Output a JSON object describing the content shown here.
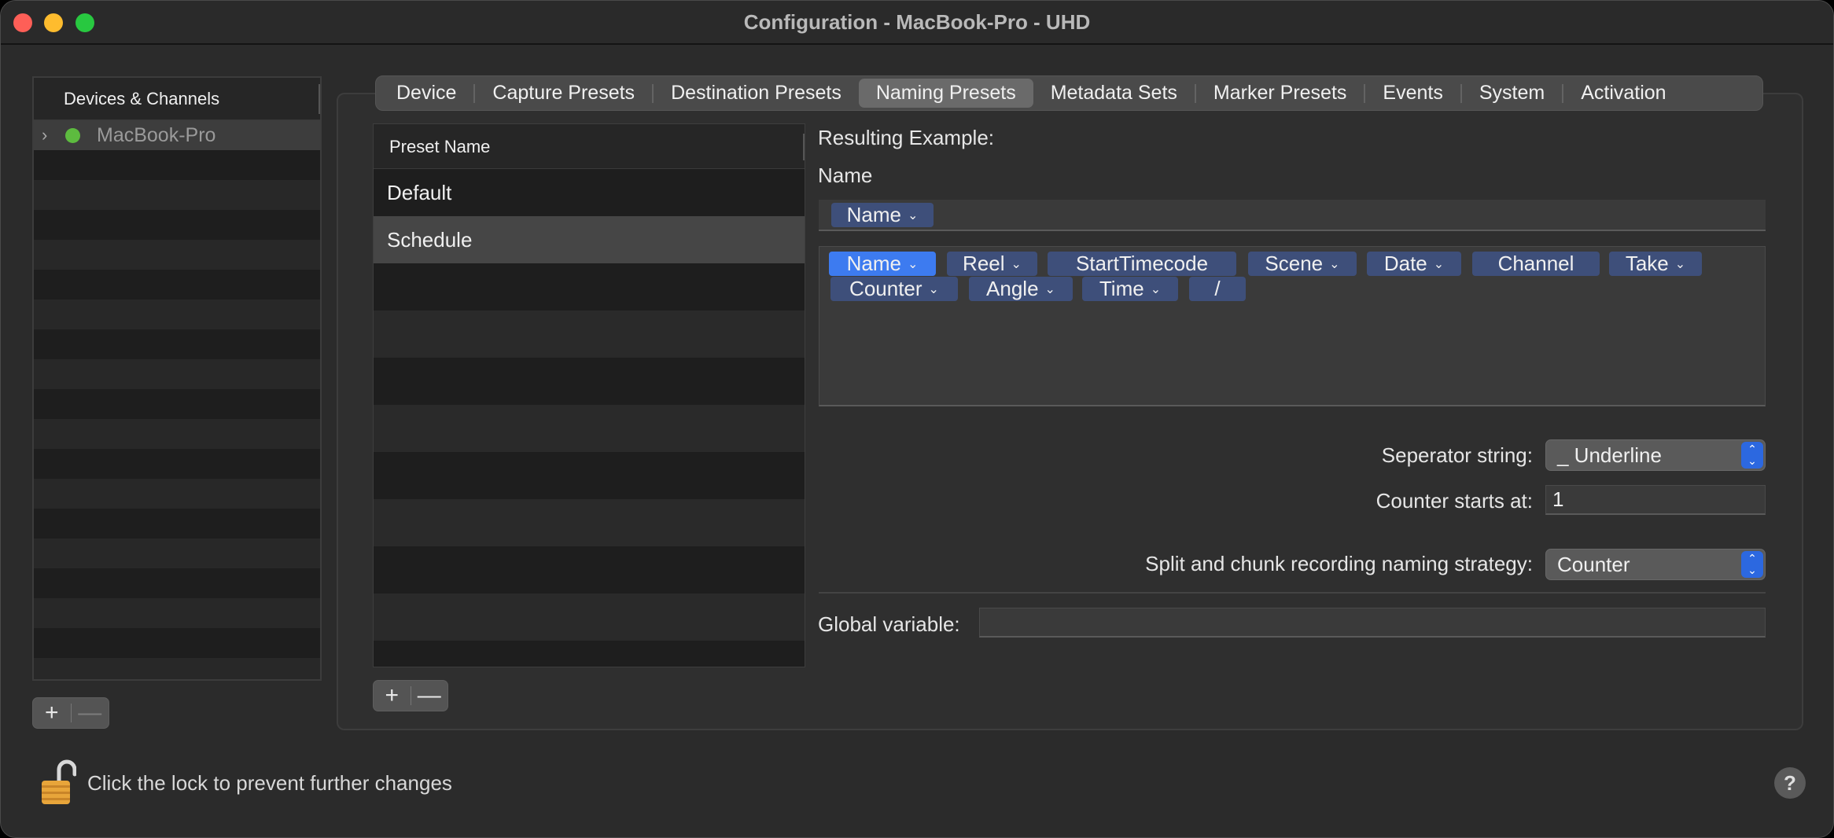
{
  "window": {
    "title": "Configuration - MacBook-Pro - UHD"
  },
  "devices": {
    "header": "Devices & Channels",
    "items": [
      {
        "label": "MacBook-Pro",
        "status_color": "#5dbb3f"
      }
    ],
    "add_label": "+",
    "remove_label": "—"
  },
  "tabs": [
    {
      "label": "Device"
    },
    {
      "label": "Capture Presets"
    },
    {
      "label": "Destination Presets"
    },
    {
      "label": "Naming Presets",
      "active": true
    },
    {
      "label": "Metadata Sets"
    },
    {
      "label": "Marker Presets"
    },
    {
      "label": "Events"
    },
    {
      "label": "System"
    },
    {
      "label": "Activation"
    }
  ],
  "presets": {
    "header": "Preset Name",
    "rows": [
      {
        "label": "Default"
      },
      {
        "label": "Schedule",
        "selected": true
      }
    ],
    "add_label": "+",
    "remove_label": "—"
  },
  "naming": {
    "resulting_example_label": "Resulting Example:",
    "name_label": "Name",
    "example_tokens": [
      {
        "label": "Name"
      }
    ],
    "available_tokens": [
      {
        "label": "Name",
        "selected": true
      },
      {
        "label": "Reel"
      },
      {
        "label": "StartTimecode"
      },
      {
        "label": "Scene"
      },
      {
        "label": "Date"
      },
      {
        "label": "Channel"
      },
      {
        "label": "Take"
      },
      {
        "label": "Counter"
      },
      {
        "label": "Angle"
      },
      {
        "label": "Time"
      },
      {
        "label": "/"
      }
    ],
    "separator_label": "Seperator string:",
    "separator_value": "_ Underline",
    "counter_label": "Counter starts at:",
    "counter_value": "1",
    "split_label": "Split and chunk recording naming strategy:",
    "split_value": "Counter",
    "global_label": "Global variable:",
    "global_value": ""
  },
  "footer": {
    "lock_text": "Click the lock to prevent further changes",
    "help_label": "?"
  },
  "colors": {
    "token": "#3e4f7a",
    "token_selected": "#3d7bf0",
    "popup_accent": "#2c68e0"
  }
}
